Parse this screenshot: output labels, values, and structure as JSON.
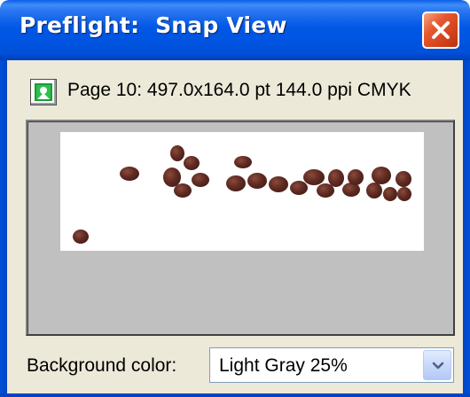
{
  "window": {
    "title": "Preflight:  Snap View",
    "close_icon": "close-icon"
  },
  "info": {
    "page_icon": "page-preview-icon",
    "text": "Page 10: 497.0x164.0 pt 144.0 ppi CMYK"
  },
  "preview": {
    "background_color": "#c0c0c0",
    "image_background": "#ffffff",
    "bean_color": "#5e2a22"
  },
  "background_color_control": {
    "label": "Background color:",
    "selected": "Light Gray 25%",
    "dropdown_icon": "chevron-down-icon"
  },
  "colors": {
    "titlebar_blue": "#0054e0",
    "close_red": "#d2421c",
    "window_face": "#ece9d8"
  }
}
